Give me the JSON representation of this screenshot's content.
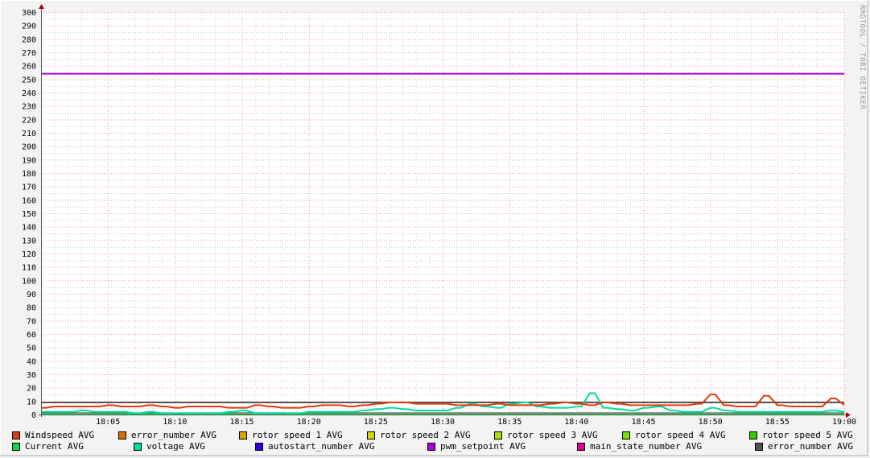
{
  "watermark": "RRDTOOL / TOBI OETIKER",
  "chart_data": {
    "type": "line",
    "title": "",
    "xlabel": "",
    "ylabel": "",
    "ylim": [
      0,
      300
    ],
    "y_ticks": [
      0,
      10,
      20,
      30,
      40,
      50,
      60,
      70,
      80,
      90,
      100,
      110,
      120,
      130,
      140,
      150,
      160,
      170,
      180,
      190,
      200,
      210,
      220,
      230,
      240,
      250,
      260,
      270,
      280,
      290,
      300
    ],
    "x_start_minute": 0,
    "x_end_minute": 60,
    "x_ticks": [
      {
        "minute": 5,
        "label": "18:05"
      },
      {
        "minute": 10,
        "label": "18:10"
      },
      {
        "minute": 15,
        "label": "18:15"
      },
      {
        "minute": 20,
        "label": "18:20"
      },
      {
        "minute": 25,
        "label": "18:25"
      },
      {
        "minute": 30,
        "label": "18:30"
      },
      {
        "minute": 35,
        "label": "18:35"
      },
      {
        "minute": 40,
        "label": "18:40"
      },
      {
        "minute": 45,
        "label": "18:45"
      },
      {
        "minute": 50,
        "label": "18:50"
      },
      {
        "minute": 55,
        "label": "18:55"
      },
      {
        "minute": 60,
        "label": "19:00"
      }
    ],
    "grid": true,
    "legend_placement": "bottom",
    "series": [
      {
        "name": "Windspeed AVG",
        "color": "#e03c0c",
        "values": [
          5,
          6,
          6,
          6,
          6,
          7,
          6,
          6,
          7,
          6,
          5,
          6,
          6,
          6,
          5,
          5,
          7,
          6,
          5,
          5,
          6,
          7,
          7,
          6,
          7,
          8,
          9,
          9,
          8,
          8,
          8,
          7,
          7,
          7,
          8,
          7,
          7,
          7,
          8,
          9,
          8,
          7,
          9,
          8,
          7,
          7,
          7,
          7,
          7,
          8,
          15,
          7,
          6,
          6,
          14,
          7,
          6,
          6,
          6,
          12,
          7
        ]
      },
      {
        "name": "error_number AVG",
        "color": "#d7700c",
        "constant": 0
      },
      {
        "name": "rotor speed 1 AVG",
        "color": "#d9a800",
        "constant": 0
      },
      {
        "name": "rotor speed 2 AVG",
        "color": "#d8d800",
        "constant": 0
      },
      {
        "name": "rotor speed 3 AVG",
        "color": "#aadd00",
        "constant": 0
      },
      {
        "name": "rotor speed 4 AVG",
        "color": "#77dd00",
        "constant": 0
      },
      {
        "name": "rotor speed 5 AVG",
        "color": "#33cc00",
        "constant": 0
      },
      {
        "name": "Current AVG",
        "color": "#00dd44",
        "constant": 0.5
      },
      {
        "name": "voltage AVG",
        "color": "#00dda0",
        "values": [
          2,
          2,
          2,
          3,
          2,
          2,
          2,
          1,
          2,
          1,
          1,
          1,
          1,
          1,
          2,
          3,
          1,
          1,
          1,
          1,
          2,
          2,
          2,
          2,
          3,
          4,
          5,
          4,
          3,
          3,
          3,
          5,
          8,
          6,
          5,
          8,
          9,
          6,
          5,
          5,
          6,
          16,
          5,
          4,
          3,
          5,
          6,
          3,
          2,
          2,
          5,
          3,
          2,
          2,
          2,
          2,
          2,
          2,
          2,
          3,
          2
        ]
      },
      {
        "name": "autostart_number AVG",
        "color": "#3300dd",
        "constant": 0
      },
      {
        "name": "pwm_setpoint AVG",
        "color": "#aa00dd",
        "constant": 254
      },
      {
        "name": "main_state_number AVG",
        "color": "#dd0099",
        "constant": 1
      },
      {
        "name": "error_number AVG",
        "color": "#555555",
        "constant": 9
      }
    ]
  }
}
